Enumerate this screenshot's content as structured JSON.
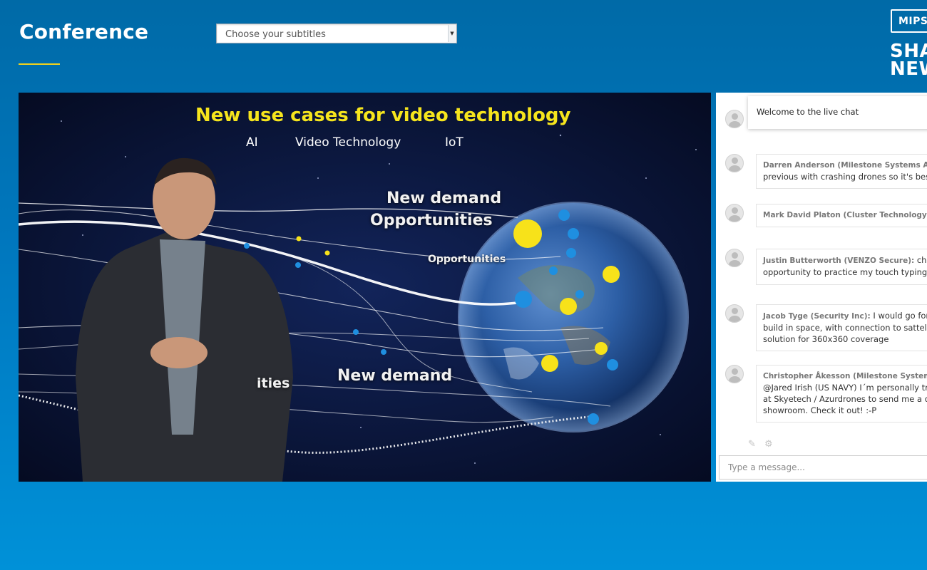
{
  "header": {
    "title": "Conference",
    "subtitle_select": {
      "selected": "Choose your subtitles"
    },
    "brand_badge": "MIPS",
    "brand_tagline_line1": "SHA",
    "brand_tagline_line2": "NEW"
  },
  "video": {
    "slide_title": "New use cases for video technology",
    "topics": [
      "AI",
      "Video Technology",
      "IoT"
    ],
    "labels": {
      "new_demand_top": "New demand",
      "opportunities_large": "Opportunities",
      "opportunities_small": "Opportunities",
      "new_demand_bottom": "New demand",
      "partial_left": "ities"
    }
  },
  "chat": {
    "welcome": "Welcome to the live chat",
    "messages": [
      {
        "author": "Darren Anderson (Milestone Systems A/S Main",
        "lines": [
          "previous with crashing drones so it's best i d"
        ]
      },
      {
        "author": "Mark David Platon (Cluster Technology Solutio",
        "lines": []
      },
      {
        "author": "Justin Butterworth (VENZO Secure):",
        "first_text": "chat is a g",
        "lines": [
          "opportunity to practice my touch typing!"
        ]
      },
      {
        "author": "Jacob Tyge (Security Inc):",
        "first_text": "I would go for a clo",
        "lines": [
          "build in space, with connection to sattelites t",
          "solution for 360x360 coverage"
        ]
      },
      {
        "author": "Christopher Åkesson (Milestone Systems A/S M",
        "lines": [
          "@Jared Irish (US NAVY) I´m personally trying",
          "at Skyetech / Azurdrones to send me a dem",
          "showroom. Check it out! :-P"
        ]
      }
    ],
    "input_placeholder": "Type a message...",
    "tool_icons": [
      "pin-icon",
      "gear-icon"
    ]
  },
  "colors": {
    "background": "#0078bf",
    "accent_yellow": "#f2d21b",
    "slide_title": "#f6e51d"
  }
}
